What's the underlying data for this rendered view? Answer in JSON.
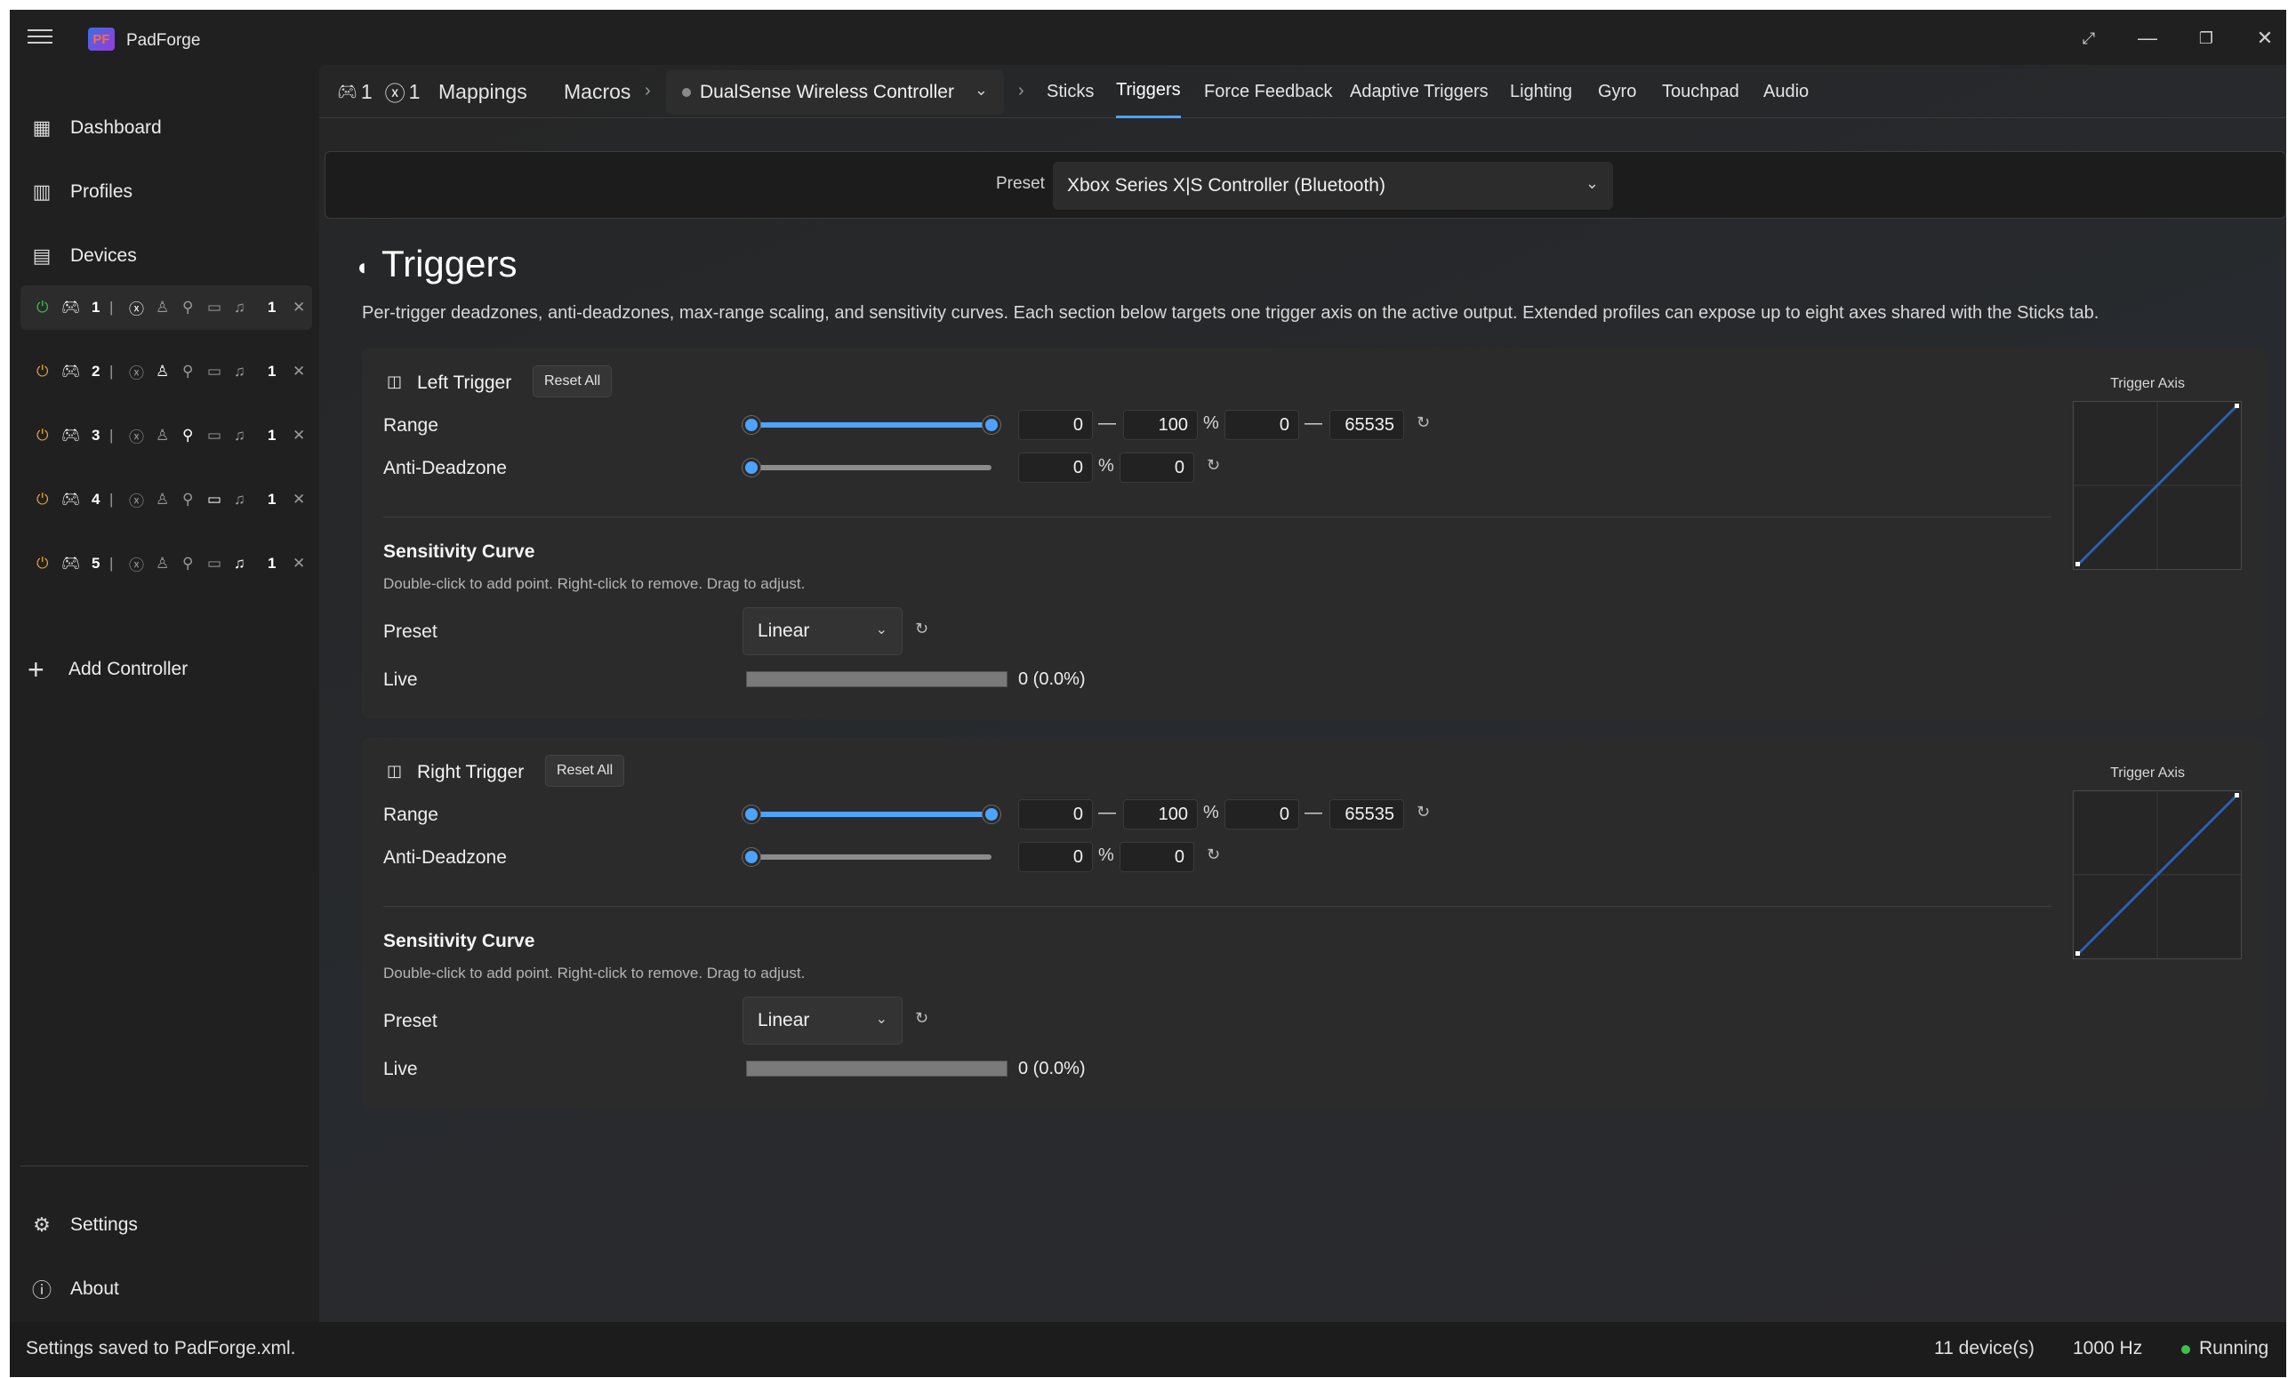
{
  "app": {
    "title": "PadForge",
    "logo_text": "PF"
  },
  "sidebar": {
    "nav": [
      {
        "label": "Dashboard",
        "icon": "dashboard-icon"
      },
      {
        "label": "Profiles",
        "icon": "profiles-icon"
      },
      {
        "label": "Devices",
        "icon": "devices-icon"
      }
    ],
    "controllers": [
      {
        "slot": "1",
        "count": "1",
        "power": "on"
      },
      {
        "slot": "2",
        "count": "1",
        "power": "off"
      },
      {
        "slot": "3",
        "count": "1",
        "power": "off"
      },
      {
        "slot": "4",
        "count": "1",
        "power": "off"
      },
      {
        "slot": "5",
        "count": "1",
        "power": "off"
      }
    ],
    "add_controller": "Add Controller",
    "footer": [
      {
        "label": "Settings",
        "icon": "gear-icon"
      },
      {
        "label": "About",
        "icon": "info-icon"
      }
    ]
  },
  "tabbar": {
    "gamepad_count": "1",
    "xbox_count": "1",
    "mappings": "Mappings",
    "macros": "Macros",
    "device": "DualSense Wireless Controller",
    "tabs": [
      "Sticks",
      "Triggers",
      "Force Feedback",
      "Adaptive Triggers",
      "Lighting",
      "Gyro",
      "Touchpad",
      "Audio"
    ],
    "selected_tab": "Triggers"
  },
  "preset": {
    "label": "Preset",
    "value": "Xbox Series X|S Controller (Bluetooth)"
  },
  "page": {
    "title": "Triggers",
    "description": "Per-trigger deadzones, anti-deadzones, max-range scaling, and sensitivity curves. Each section below targets one trigger axis on the active output. Extended profiles can expose up to eight axes shared with the Sticks tab."
  },
  "triggers": [
    {
      "title": "Left Trigger",
      "reset_all": "Reset All",
      "range_label": "Range",
      "range_min_pct": "0",
      "range_max_pct": "100",
      "pct": "%",
      "range_min_raw": "0",
      "range_max_raw": "65535",
      "anti_label": "Anti-Deadzone",
      "anti_pct": "0",
      "anti_raw": "0",
      "curve_title": "Sensitivity Curve",
      "curve_hint": "Double-click to add point. Right-click to remove. Drag to adjust.",
      "preset_label": "Preset",
      "preset_value": "Linear",
      "live_label": "Live",
      "live_value": "0 (0.0%)",
      "axis_label": "Trigger Axis"
    },
    {
      "title": "Right Trigger",
      "reset_all": "Reset All",
      "range_label": "Range",
      "range_min_pct": "0",
      "range_max_pct": "100",
      "pct": "%",
      "range_min_raw": "0",
      "range_max_raw": "65535",
      "anti_label": "Anti-Deadzone",
      "anti_pct": "0",
      "anti_raw": "0",
      "curve_title": "Sensitivity Curve",
      "curve_hint": "Double-click to add point. Right-click to remove. Drag to adjust.",
      "preset_label": "Preset",
      "preset_value": "Linear",
      "live_label": "Live",
      "live_value": "0 (0.0%)",
      "axis_label": "Trigger Axis"
    }
  ],
  "status": {
    "message": "Settings saved to PadForge.xml.",
    "devices": "11 device(s)",
    "rate": "1000 Hz",
    "state": "Running"
  },
  "colors": {
    "accent": "#4da3ff",
    "running": "#3cc04a",
    "power_off": "#e0a030"
  }
}
